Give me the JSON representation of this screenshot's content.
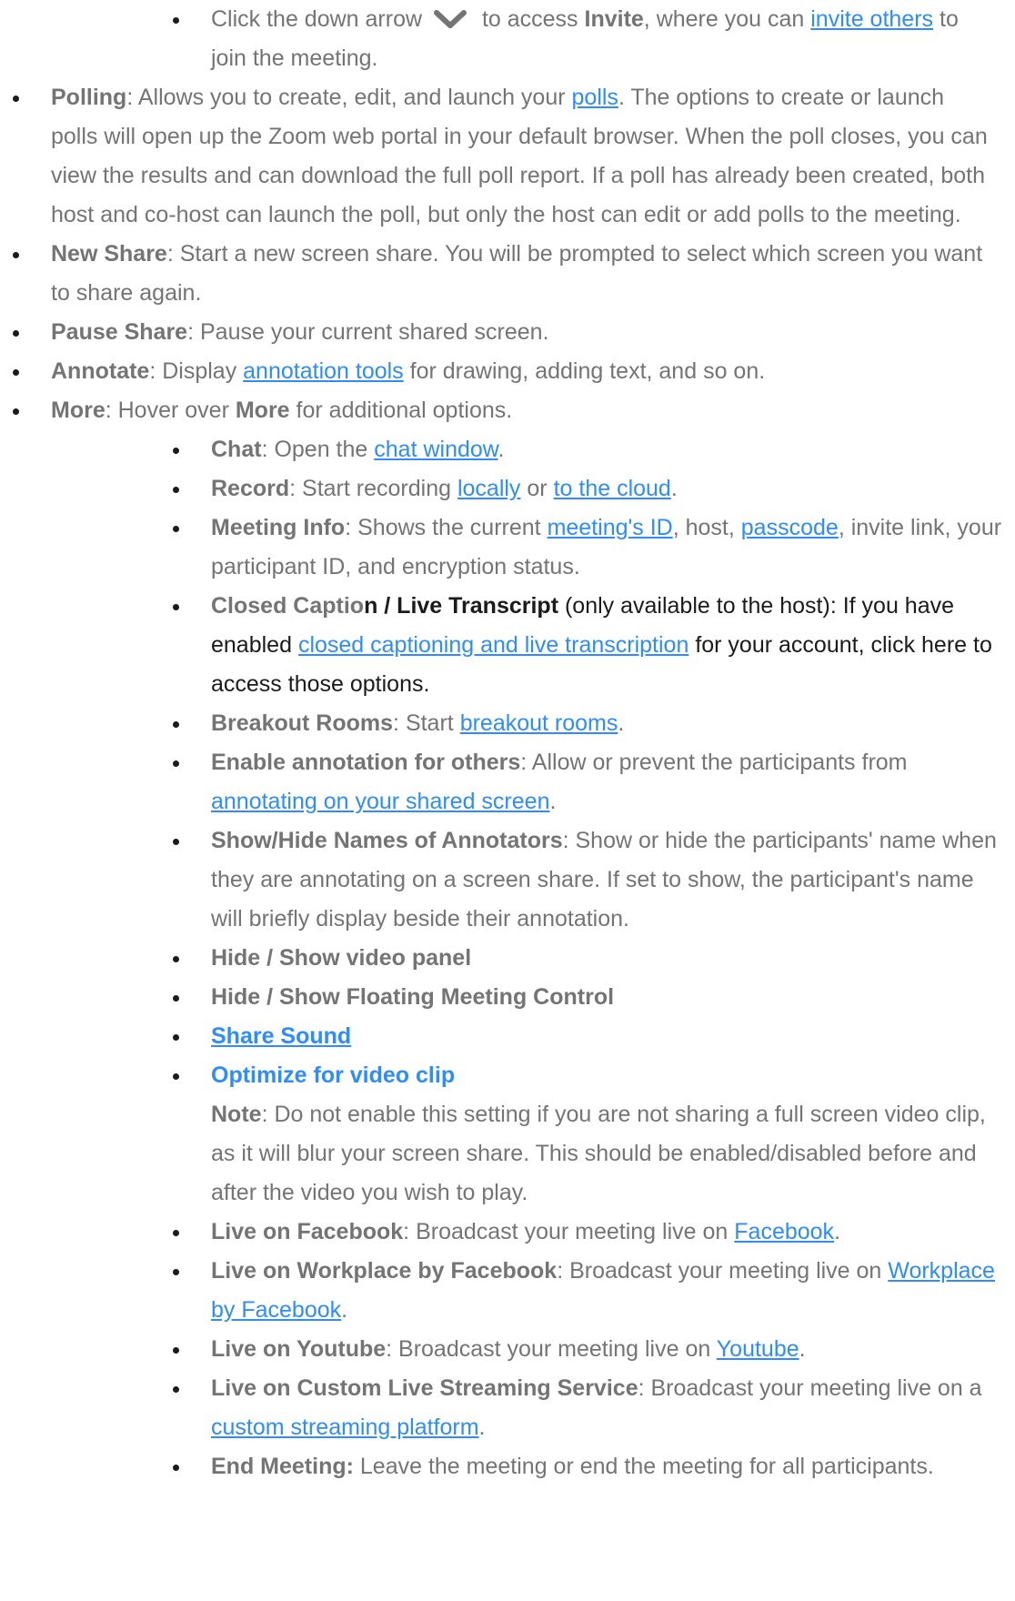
{
  "colors": {
    "text": "#747474",
    "link": "#2d8cff",
    "dark": "#1b1b1b"
  },
  "invite_item": {
    "t1": "Click the down arrow",
    "icon": "chevron-down-icon",
    "t2": "to access",
    "b1": "Invite",
    "t3": ", where you can",
    "link": "invite others",
    "t4": "to join the meeting."
  },
  "polling": {
    "label": "Polling",
    "t1": ": Allows you to create, edit, and launch your",
    "link": "polls",
    "t2": ". The options to create or launch polls will open up the Zoom web portal in your default browser. When the poll closes, you can view the results and can download the full poll report. If a poll has already been created, both host and co-host can launch the poll, but only the host can edit or add polls to the meeting."
  },
  "new_share": {
    "label": "New Share",
    "text": ": Start a new screen share. You will be prompted to select which screen you want to share again."
  },
  "pause_share": {
    "label": "Pause Share",
    "text": ": Pause your current shared screen."
  },
  "annotate": {
    "label": "Annotate",
    "t1": ": Display",
    "link": "annotation tools",
    "t2": "for drawing, adding text, and so on."
  },
  "more": {
    "label": "More",
    "t1": ": Hover over",
    "b1": "More",
    "t2": "for additional options."
  },
  "more_items": {
    "chat": {
      "label": "Chat",
      "t1": ": Open the",
      "link": "chat window",
      "t2": "."
    },
    "record": {
      "label": "Record",
      "t1": ": Start recording",
      "link1": "locally",
      "t2": "or",
      "link2": "to the cloud",
      "t3": "."
    },
    "meeting_info": {
      "label": "Meeting Info",
      "t1": ": Shows the current",
      "link1": "meeting's ID",
      "t2": ", host,",
      "link2": "passcode",
      "t3": ", invite link, your participant ID, and encryption status."
    },
    "closed_caption": {
      "label_a": "Closed Captio",
      "label_b": "n / Live Transcript",
      "t1": "(only available to the host): If you have enabled",
      "link": "closed captioning and live transcription",
      "t2": "for your account, click here to access those options."
    },
    "breakout": {
      "label": "Breakout Rooms",
      "t1": ": Start",
      "link": "breakout rooms",
      "t2": "."
    },
    "enable_annotation": {
      "label": "Enable annotation for others",
      "t1": ": Allow or prevent the participants from",
      "link": "annotating on your shared screen",
      "t2": "."
    },
    "show_hide_names": {
      "label": "Show/Hide Names of Annotators",
      "text": ": Show or hide the participants' name when they are annotating on a screen share. If set to show, the participant's name will briefly display beside their annotation."
    },
    "video_panel": {
      "label": "Hide / Show video panel"
    },
    "floating_control": {
      "label": "Hide / Show Floating Meeting Control"
    },
    "share_sound": {
      "label": "Share Sound"
    },
    "optimize": {
      "label": "Optimize for video clip",
      "note_label": "Note",
      "note_text": ": Do not enable this setting if you are not sharing a full screen video clip, as it will blur your screen share. This should be enabled/disabled before and after the video you wish to play."
    },
    "live_facebook": {
      "label": "Live on Facebook",
      "t1": ": Broadcast your meeting live on",
      "link": "Facebook",
      "t2": "."
    },
    "live_workplace": {
      "label": "Live on Workplace by Facebook",
      "t1": ": Broadcast your meeting live on",
      "link": "Workplace by Facebook",
      "t2": "."
    },
    "live_youtube": {
      "label": "Live on Youtube",
      "t1": ": Broadcast your meeting live on",
      "link": "Youtube",
      "t2": "."
    },
    "live_custom": {
      "label": "Live on Custom Live Streaming Service",
      "t1": ": Broadcast your meeting live on a",
      "link": "custom streaming platform",
      "t2": "."
    },
    "end_meeting": {
      "label": "End Meeting:",
      "text": "Leave the meeting or end the meeting for all participants."
    }
  }
}
